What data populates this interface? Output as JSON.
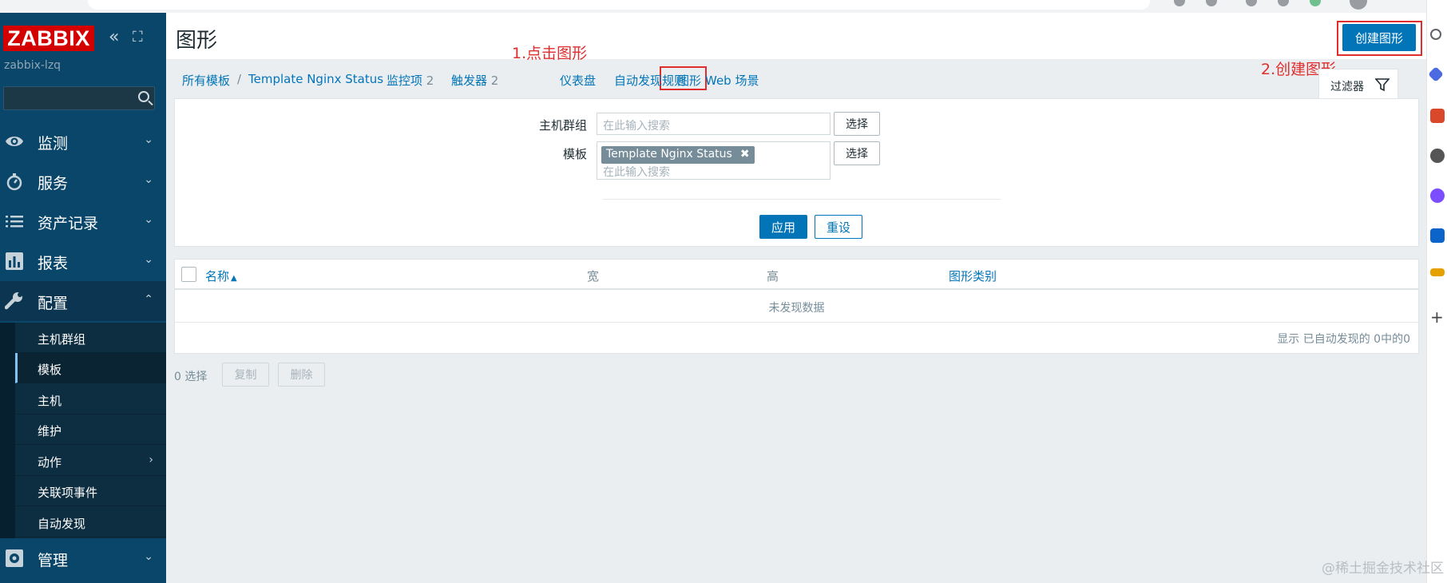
{
  "sidebar": {
    "logo": "ZABBIX",
    "server_name": "zabbix-lzq",
    "collapse_glyph": "«",
    "kiosk_glyph": "⛶",
    "menu": [
      {
        "label": "监测",
        "icon": "eye-icon"
      },
      {
        "label": "服务",
        "icon": "stopwatch-icon"
      },
      {
        "label": "资产记录",
        "icon": "list-icon"
      },
      {
        "label": "报表",
        "icon": "bar-chart-icon"
      },
      {
        "label": "配置",
        "icon": "wrench-icon"
      },
      {
        "label": "管理",
        "icon": "cog-icon"
      }
    ],
    "submenu": [
      "主机群组",
      "模板",
      "主机",
      "维护",
      "动作",
      "关联项事件",
      "自动发现"
    ],
    "chevron_down": "⌄",
    "chevron_up": "⌃",
    "chevron_right": "›"
  },
  "header": {
    "title": "图形",
    "create_button": "创建图形"
  },
  "breadcrumb": {
    "all_templates": "所有模板",
    "separator": "/",
    "template": "Template Nginx Status",
    "items": "监控项",
    "items_count": "2",
    "triggers": "触发器",
    "triggers_count": "2",
    "graphs": "图形",
    "dashboards": "仪表盘",
    "discovery": "自动发现规则",
    "web": "Web 场景"
  },
  "annotations": {
    "step1": "1.点击图形",
    "step2": "2.创建图形"
  },
  "filter": {
    "tab_label": "过滤器",
    "host_group_label": "主机群组",
    "template_label": "模板",
    "placeholder": "在此输入搜索",
    "template_chip": "Template Nginx Status",
    "chip_remove": "✖",
    "select_button": "选择",
    "apply": "应用",
    "reset": "重设"
  },
  "table": {
    "col_name": "名称",
    "sort_glyph": "▲",
    "col_width": "宽",
    "col_height": "高",
    "col_type": "图形类别",
    "no_data": "未发现数据",
    "paging": "显示 已自动发现的 0中的0"
  },
  "actions": {
    "selected": "0 选择",
    "copy": "复制",
    "delete": "删除"
  },
  "watermark": "@稀土掘金技术社区",
  "colors": {
    "sidebar": "#0a466a",
    "logo": "#d40000",
    "primary": "#0275b8",
    "annotation": "#e02d2d"
  }
}
